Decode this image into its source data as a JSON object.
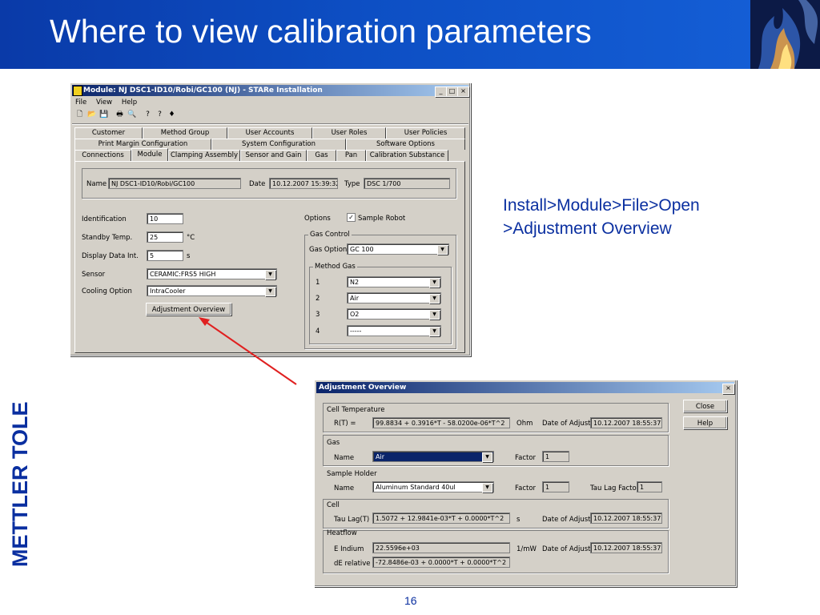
{
  "slide": {
    "title": "Where to view calibration parameters",
    "note_line1": "Install>Module>File>Open",
    "note_line2": ">Adjustment Overview",
    "page_number": "16",
    "logo_text": "METTLER TOLEDO",
    "colors": {
      "header": "#0d4fc4",
      "note": "#0a2fa0",
      "arrow": "#e02020"
    }
  },
  "module_window": {
    "title": "Module: NJ DSC1-ID10/Robi/GC100 (NJ) - STARe Installation",
    "menu": [
      "File",
      "View",
      "Help"
    ],
    "tabs_row1": [
      "Customer",
      "Method Group",
      "User Accounts",
      "User Roles",
      "User Policies"
    ],
    "tabs_row2": [
      "Print Margin Configuration",
      "System Configuration",
      "Software Options"
    ],
    "tabs_row3": [
      "Connections",
      "Module",
      "Clamping Assembly",
      "Sensor and Gain",
      "Gas",
      "Pan",
      "Calibration Substance"
    ],
    "name_label": "Name",
    "name_value": "NJ DSC1-ID10/Robi/GC100",
    "date_label": "Date",
    "date_value": "10.12.2007 15:39:32",
    "type_label": "Type",
    "type_value": "DSC 1/700",
    "identification_label": "Identification",
    "identification_value": "10",
    "standby_label": "Standby Temp.",
    "standby_value": "25",
    "standby_unit": "°C",
    "display_label": "Display Data Int.",
    "display_value": "5",
    "display_unit": "s",
    "sensor_label": "Sensor",
    "sensor_value": "CERAMIC:FRS5 HIGH",
    "cooling_label": "Cooling Option",
    "cooling_value": "IntraCooler",
    "adjustment_button": "Adjustment Overview",
    "options_label": "Options",
    "sample_robot_label": "Sample Robot",
    "sample_robot_checked": "✓",
    "gas_control_label": "Gas Control",
    "gas_option_label": "Gas Option",
    "gas_option_value": "GC 100",
    "method_gas_label": "Method Gas",
    "method_gas": [
      {
        "num": "1",
        "value": "N2"
      },
      {
        "num": "2",
        "value": "Air"
      },
      {
        "num": "3",
        "value": "O2"
      },
      {
        "num": "4",
        "value": "-----"
      }
    ]
  },
  "adjust_window": {
    "title": "Adjustment Overview",
    "close_button": "Close",
    "help_button": "Help",
    "cell_temp_label": "Cell Temperature",
    "rt_label": "R(T) =",
    "rt_value": "99.8834 + 0.3916*T - 58.0200e-06*T^2",
    "rt_unit": "Ohm",
    "date_adj_label": "Date of Adjust.",
    "rt_date": "10.12.2007 18:55:37",
    "gas_label": "Gas",
    "gas_name_label": "Name",
    "gas_name_value": "Air",
    "factor_label": "Factor",
    "gas_factor": "1",
    "holder_label": "Sample Holder",
    "holder_name_label": "Name",
    "holder_name_value": "Aluminum Standard 40ul",
    "holder_factor": "1",
    "tau_lag_factor_label": "Tau Lag Factor",
    "tau_lag_factor": "1",
    "cell_label": "Cell",
    "tau_lag_label": "Tau Lag(T) =",
    "tau_lag_value": "1.5072 + 12.9841e-03*T + 0.0000*T^2",
    "tau_unit": "s",
    "tau_date": "10.12.2007 18:55:37",
    "heatflow_label": "Heatflow",
    "e_indium_label": "E Indium",
    "e_indium_value": "22.5596e+03",
    "e_unit": "1/mW",
    "e_date": "10.12.2007 18:55:37",
    "de_label": "dE relative",
    "de_value": "-72.8486e-03 + 0.0000*T + 0.0000*T^2"
  }
}
